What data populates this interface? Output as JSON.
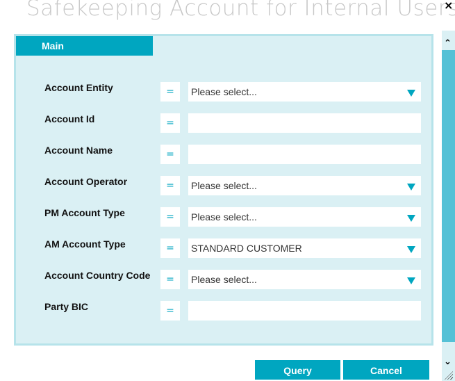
{
  "window": {
    "title": "Safekeeping Account for Internal Users",
    "close_icon": "×"
  },
  "tabs": [
    {
      "label": "Main"
    }
  ],
  "form": {
    "rows": [
      {
        "label": "Account Entity",
        "operator": "=",
        "type": "select",
        "value": "Please select..."
      },
      {
        "label": "Account Id",
        "operator": "=",
        "type": "text",
        "value": ""
      },
      {
        "label": "Account Name",
        "operator": "=",
        "type": "text",
        "value": ""
      },
      {
        "label": "Account Operator",
        "operator": "=",
        "type": "select",
        "value": "Please select..."
      },
      {
        "label": "PM Account Type",
        "operator": "=",
        "type": "select",
        "value": "Please select..."
      },
      {
        "label": "AM Account Type",
        "operator": "=",
        "type": "select",
        "value": "STANDARD CUSTOMER"
      },
      {
        "label": "Account Country Code",
        "operator": "=",
        "type": "select",
        "value": "Please select..."
      },
      {
        "label": "Party BIC",
        "operator": "=",
        "type": "text",
        "value": ""
      }
    ]
  },
  "buttons": {
    "query": "Query",
    "cancel": "Cancel"
  },
  "scrollbar": {
    "up": "⌃",
    "down": "⌄"
  },
  "colors": {
    "accent": "#00a6c0",
    "panel_bg": "#daf0f4",
    "panel_border": "#b6e3ea",
    "title_text": "#c8c8c8"
  }
}
